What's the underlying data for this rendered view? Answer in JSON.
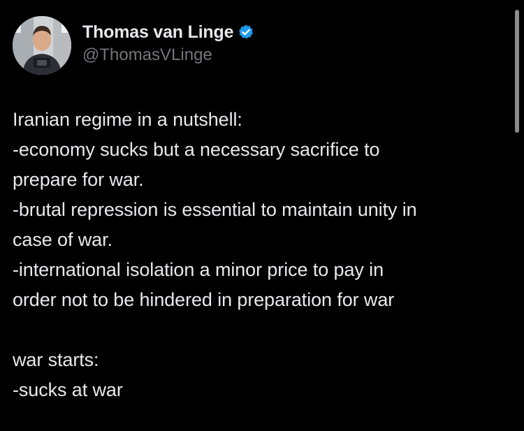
{
  "tweet": {
    "author": {
      "display_name": "Thomas van Linge",
      "handle": "@ThomasVLinge",
      "verified": true,
      "verified_icon": "verified-badge-icon",
      "verified_color": "#1d9bf0"
    },
    "lines_block_1": [
      "Iranian regime in a nutshell:",
      "-economy sucks but a necessary sacrifice to",
      "prepare for war.",
      "-brutal repression is essential to maintain unity in",
      "case of war.",
      "-international isolation a minor price to pay in",
      "order not to be hindered in preparation for war"
    ],
    "lines_block_2": [
      "war starts:",
      "-sucks at war"
    ]
  },
  "colors": {
    "background": "#000000",
    "text_primary": "#e7e9ea",
    "text_secondary": "#71767b"
  }
}
